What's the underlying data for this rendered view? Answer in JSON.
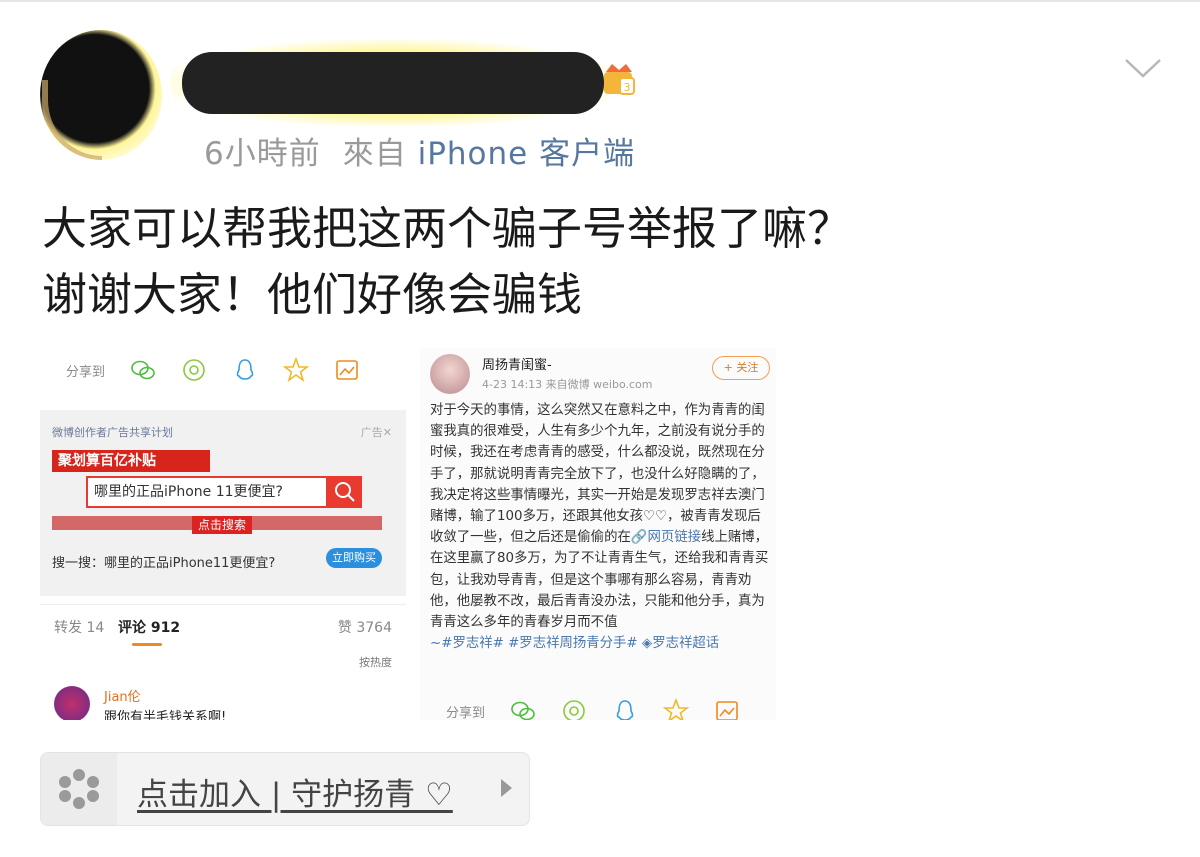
{
  "post": {
    "time": "6小時前",
    "source_prefix": "來自",
    "source_app": "iPhone 客户端",
    "text_line1": "大家可以帮我把这两个骗子号举报了嘛？",
    "text_line2": "谢谢大家！他们好像会骗钱",
    "avatar_icon": "redacted-avatar",
    "name_icon": "redacted-username",
    "badge_icon": "vip-crown-icon",
    "menu_icon": "chevron-down-icon"
  },
  "left_shot": {
    "share_label": "分享到",
    "ad_header": "微博创作者广告共享计划",
    "ad_close": "广告✕",
    "ad_banner": "聚划算百亿补贴",
    "ad_search_query": "哪里的正品iPhone 11更便宜?",
    "ad_click": "点击搜索",
    "ad_sub": "搜一搜：哪里的正品iPhone11更便宜?",
    "ad_buy": "立即购买",
    "tab_repost": "转发 14",
    "tab_comment": "评论 912",
    "tab_like": "赞 3764",
    "sort": "按热度",
    "comment_name": "Jian伦",
    "comment_text": "跟你有半毛钱关系啊!"
  },
  "right_shot": {
    "name": "周扬青闺蜜-",
    "time": "4-23 14:13 来自微博 weibo.com",
    "follow": "+ 关注",
    "body_1": "对于今天的事情，这么突然又在意料之中，作为青青的闺蜜我真的很难受，人生有多少个九年，之前没有说分手的时候，我还在考虑青青的感受，什么都没说，既然现在分手了，那就说明青青完全放下了，也没什么好隐瞒的了，我决定将这些事情曝光，其实一开始是发现罗志祥去澳门赌博，输了100多万，还跟其他女孩♡♡，被青青发现后收敛了一些，但之后还是偷偷的在",
    "link": "🔗网页链接",
    "body_2": "线上赌博，在这里赢了80多万，为了不让青青生气，还给我和青青买包，让我劝导青青，但是这个事哪有那么容易，青青劝他，他屡教不改，最后青青没办法，只能和他分手，真为青青这么多年的青春岁月而不值",
    "tags": "~#罗志祥# #罗志祥周扬青分手# ◈罗志祥超话",
    "share_label": "分享到"
  },
  "topic_bar": {
    "text": "点击加入 | 守护扬青 ♡"
  },
  "colors": {
    "meta_gray": "#9a9a9a",
    "source_blue": "#56779f",
    "text": "#1a1a1a",
    "accent_orange": "#f08a1c",
    "ad_red": "#e83a2e"
  }
}
